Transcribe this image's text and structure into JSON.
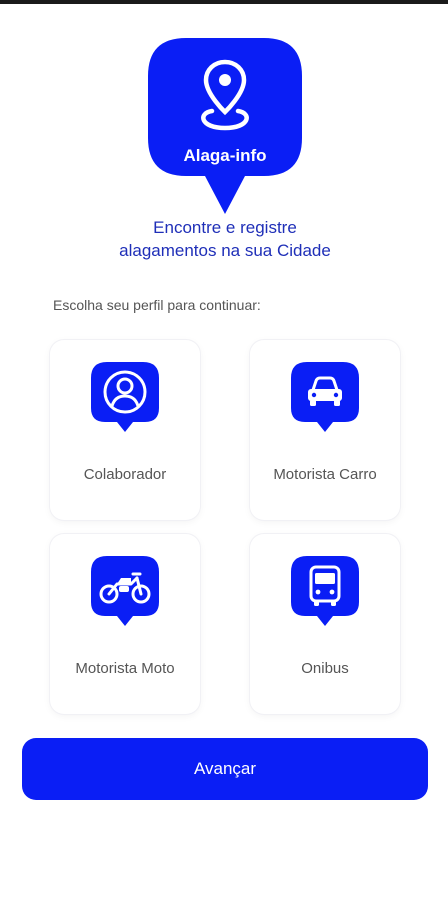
{
  "app": {
    "name": "Alaga-info",
    "logo_icon": "map-pin-icon"
  },
  "tagline": {
    "line1": "Encontre e registre",
    "line2": "alagamentos na sua Cidade"
  },
  "profile_prompt": "Escolha seu perfil para continuar:",
  "profiles": [
    {
      "label": "Colaborador",
      "icon": "user-icon"
    },
    {
      "label": "Motorista Carro",
      "icon": "car-icon"
    },
    {
      "label": "Motorista Moto",
      "icon": "motorcycle-icon"
    },
    {
      "label": "Onibus",
      "icon": "bus-icon"
    }
  ],
  "advance_button": {
    "label": "Avançar"
  },
  "colors": {
    "brand": "#0a1ef5",
    "tagline": "#1f2fb8",
    "label_text": "#555555",
    "background": "#ffffff"
  }
}
